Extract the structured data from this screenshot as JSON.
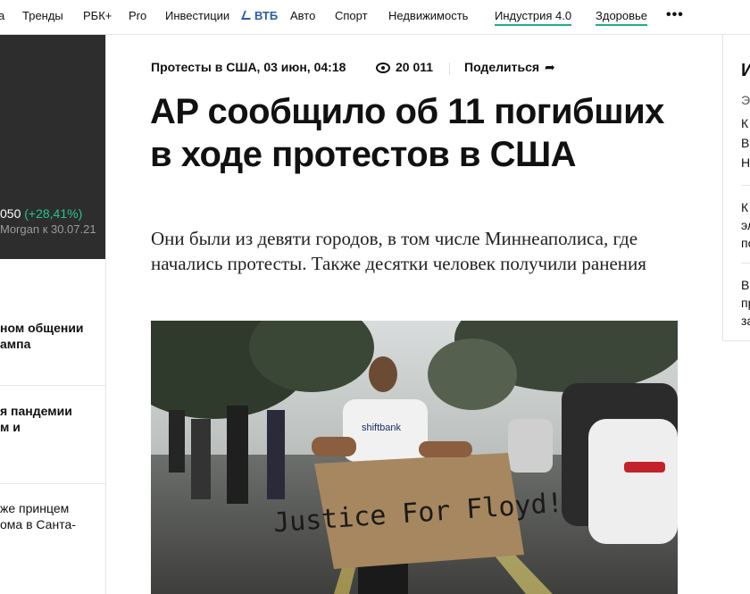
{
  "nav": {
    "items": [
      "а",
      "Тренды",
      "РБК+",
      "Pro",
      "Инвестиции"
    ],
    "sponsor": "ВТБ",
    "items2": [
      "Авто",
      "Спорт",
      "Недвижимость",
      "Индустрия 4.0",
      "Здоровье"
    ],
    "more": "•••"
  },
  "left": {
    "ticker_value": "050",
    "ticker_change": "(+28,41%)",
    "ticker_sub": "Morgan к 30.07.21",
    "news": [
      {
        "lines": [
          "ном общении",
          "ампа"
        ]
      },
      {
        "lines": [
          "я пандемии",
          "м и"
        ]
      },
      {
        "lines": [
          "же принцем",
          "ома в Санта-"
        ]
      }
    ]
  },
  "article": {
    "rubric_date": "Протесты в США, 03 июн, 04:18",
    "views": "20 011",
    "share_label": "Поделиться",
    "title": "AP сообщило об 11 погибших в ходе протестов в США",
    "subtitle": "Они были из девяти городов, в том числе Миннеаполиса, где начались протесты. Также десятки человек получили ранения",
    "photo_sign_text": "Justice For Floyd!",
    "photo_shirt_text": "shiftbank"
  },
  "right": {
    "head": "И",
    "block1": [
      "Э",
      "К",
      "В",
      "Н"
    ],
    "block2": [
      "К",
      "эл",
      "по"
    ],
    "block3": [
      "В",
      "пр",
      "за"
    ]
  },
  "colors": {
    "accent": "#1fae8a",
    "positive": "#27c48b",
    "dark": "#2d2d2d"
  }
}
